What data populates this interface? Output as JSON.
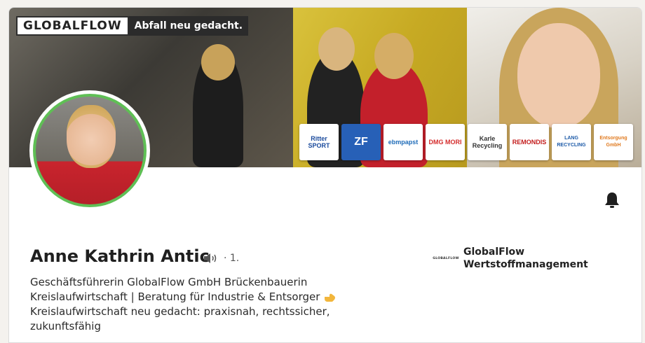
{
  "banner": {
    "brand": "GLOBALFLOW",
    "tagline": "Abfall neu gedacht.",
    "partners": [
      "Ritter SPORT",
      "ZF",
      "ebmpapst",
      "DMG MORI",
      "Karle Recycling",
      "REMONDIS",
      "LANG RECYCLING",
      "Entsorgung GmbH"
    ]
  },
  "profile": {
    "name": "Anne Kathrin Antic",
    "degree": "· 1.",
    "headline_lines": [
      "Geschäftsführerin GlobalFlow GmbH Brückenbauerin",
      "Kreislaufwirtschaft | Beratung für Industrie & Entsorger",
      "Kreislaufwirtschaft neu gedacht: praxisnah, rechtssicher,",
      "zukunftsfähig"
    ]
  },
  "company": {
    "logo_text": "GLOBALFLOW",
    "name_lines": [
      "GlobalFlow",
      "Wertstoffmanagement"
    ]
  },
  "icons": {
    "bell": "notification-bell-icon",
    "speaker": "pronunciation-speaker-icon",
    "hand": "pointing-hand-emoji"
  },
  "colors": {
    "avatar_ring": "#5fbf55",
    "tagline_bg": "#2b2b2b",
    "card_bg": "#ffffff"
  }
}
